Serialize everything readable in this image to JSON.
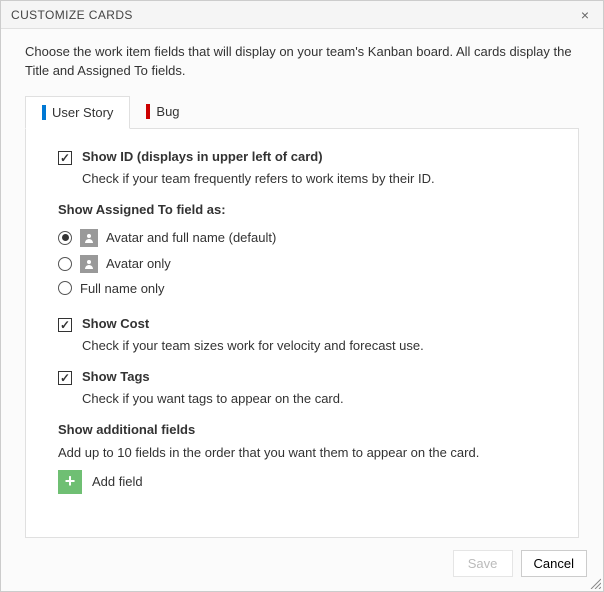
{
  "title": "CUSTOMIZE CARDS",
  "description": "Choose the work item fields that will display on your team's Kanban board. All cards display the Title and Assigned To fields.",
  "tabs": [
    {
      "label": "User Story",
      "bar_color": "#0078d4",
      "active": true
    },
    {
      "label": "Bug",
      "bar_color": "#c00",
      "active": false
    }
  ],
  "show_id": {
    "label": "Show ID (displays in upper left of card)",
    "help": "Check if your team frequently refers to work items by their ID.",
    "checked": true
  },
  "assigned_to": {
    "title": "Show Assigned To field as:",
    "options": [
      {
        "label": "Avatar and full name (default)",
        "icon": "avatar",
        "selected": true
      },
      {
        "label": "Avatar only",
        "icon": "avatar",
        "selected": false
      },
      {
        "label": "Full name only",
        "icon": null,
        "selected": false
      }
    ]
  },
  "show_cost": {
    "label": "Show Cost",
    "help": "Check if your team sizes work for velocity and forecast use.",
    "checked": true
  },
  "show_tags": {
    "label": "Show Tags",
    "help": "Check if you want tags to appear on the card.",
    "checked": true
  },
  "additional_fields": {
    "title": "Show additional fields",
    "help": "Add up to 10 fields in the order that you want them to appear on the card.",
    "add_label": "Add field"
  },
  "footer": {
    "save_label": "Save",
    "cancel_label": "Cancel",
    "save_enabled": false
  }
}
